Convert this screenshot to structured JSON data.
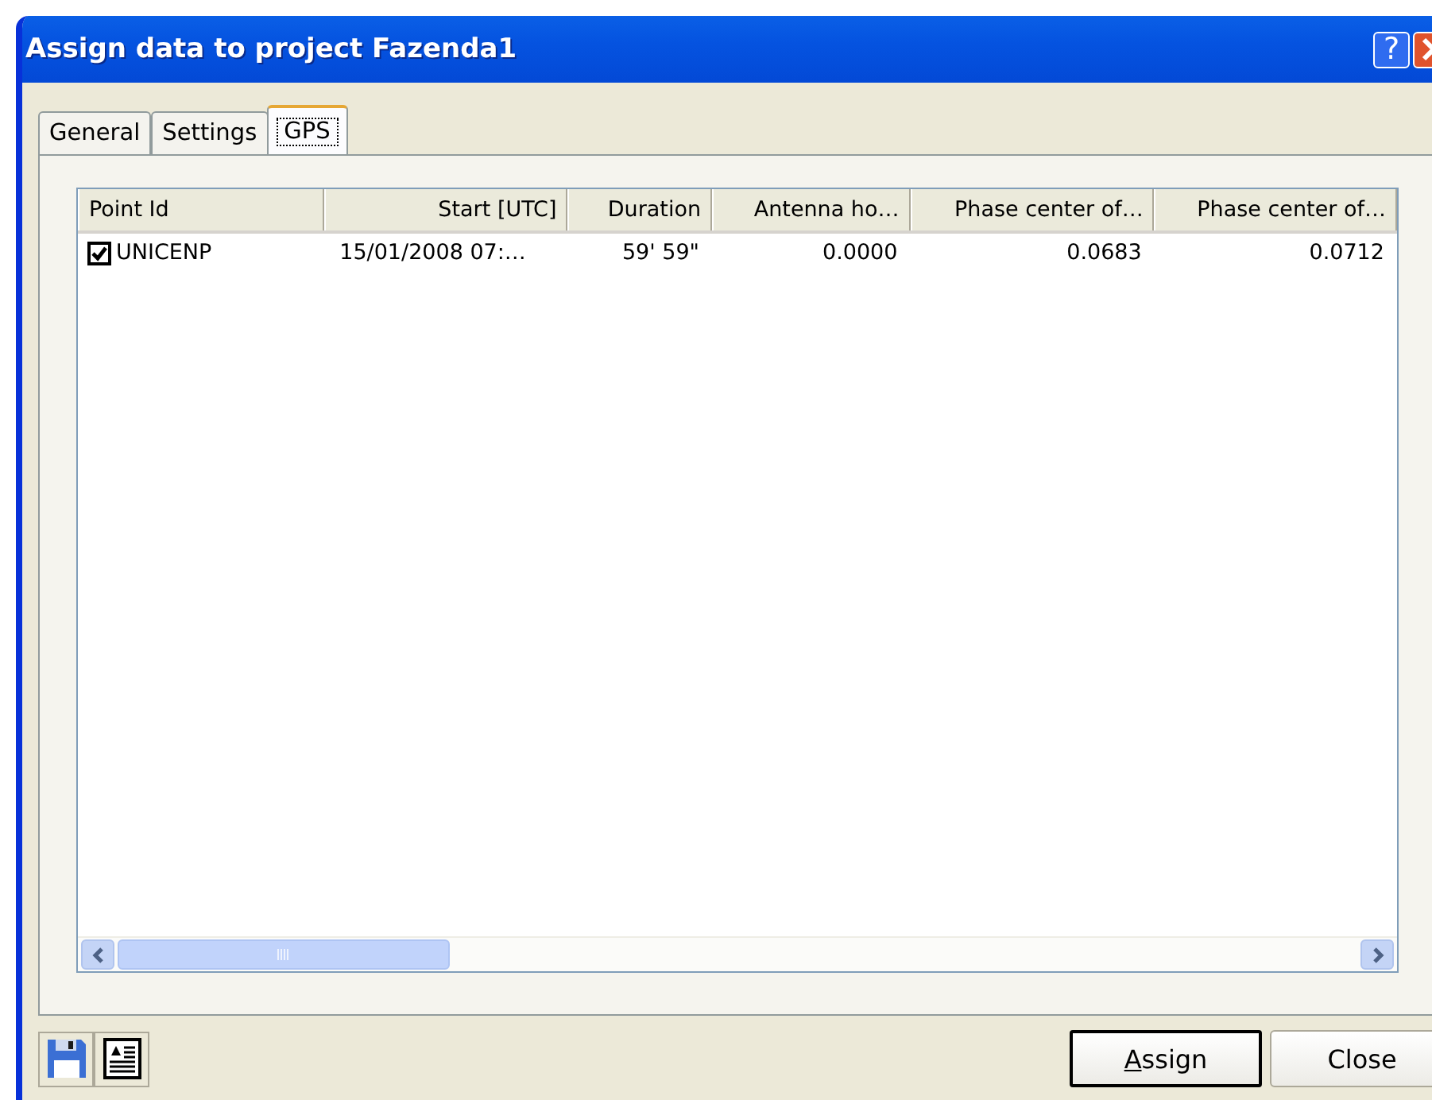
{
  "window": {
    "title": "Assign data to project Fazenda1",
    "help_button": "?"
  },
  "tabs": [
    {
      "label": "General",
      "selected": false
    },
    {
      "label": "Settings",
      "selected": false
    },
    {
      "label": "GPS",
      "selected": true
    }
  ],
  "table": {
    "columns": [
      "Point Id",
      "Start [UTC]",
      "Duration",
      "Antenna ho…",
      "Phase center of…",
      "Phase center of…"
    ],
    "rows": [
      {
        "checked": true,
        "cells": [
          "UNICENP",
          "15/01/2008 07:…",
          "59' 59\"",
          "0.0000",
          "0.0683",
          "0.0712"
        ]
      }
    ]
  },
  "buttons": [
    {
      "label": "Assign",
      "default": true
    },
    {
      "label": "Close",
      "default": false
    }
  ]
}
